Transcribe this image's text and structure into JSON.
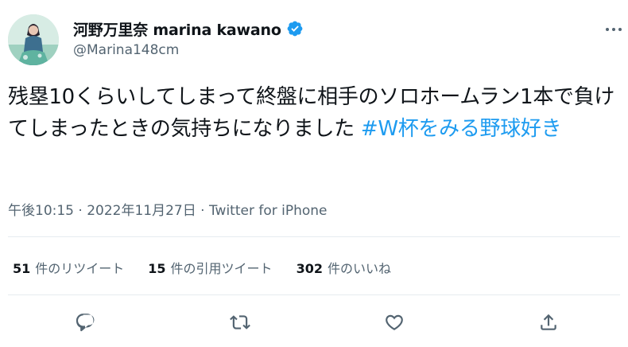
{
  "author": {
    "display_name": "河野万里奈 marina kawano",
    "handle": "@Marina148cm",
    "verified_icon": "verified-badge-icon",
    "avatar_icon": "profile-photo"
  },
  "tweet": {
    "text_before": "残塁10くらいしてしまって終盤に相手のソロホームラン1本で負けてしまったときの気持ちになりました ",
    "hashtag": "#W杯をみる野球好き"
  },
  "meta": {
    "time": "午後10:15",
    "separator1": " · ",
    "date": "2022年11月27日",
    "separator2": " · ",
    "source": "Twitter for iPhone"
  },
  "stats": {
    "retweets_count": "51",
    "retweets_label": "件のリツイート",
    "quotes_count": "15",
    "quotes_label": "件の引用ツイート",
    "likes_count": "302",
    "likes_label": "件のいいね"
  },
  "actions": {
    "reply_icon": "reply-icon",
    "retweet_icon": "retweet-icon",
    "like_icon": "heart-icon",
    "share_icon": "share-icon"
  },
  "colors": {
    "link": "#1d9bf0",
    "secondary_text": "#536471",
    "primary_text": "#0f1419",
    "divider": "#e6ecf0"
  }
}
